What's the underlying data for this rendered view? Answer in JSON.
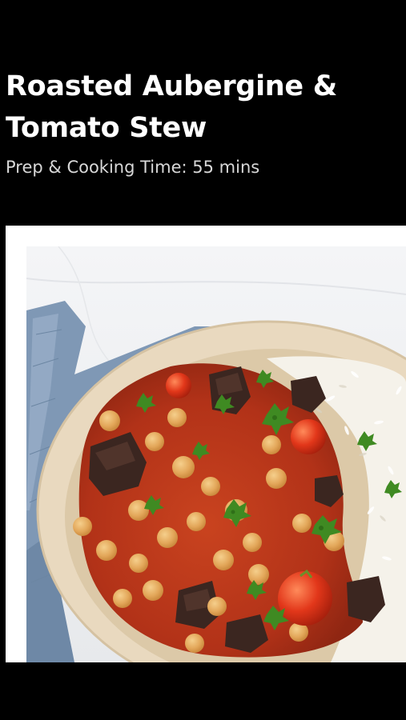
{
  "recipe": {
    "title": "Roasted Aubergine & Tomato Stew",
    "prep_time": "Prep & Cooking Time: 55 mins",
    "photo": "roasted-aubergine-tomato-stew-photo"
  },
  "colors": {
    "background": "#000000",
    "title_text": "#ffffff",
    "subtitle_text": "#d8d8d8",
    "card_border": "#ffffff",
    "napkin": "#7f98b5",
    "bowl": "#e9d9bf",
    "sauce": "#b8361a",
    "chickpea": "#e7ae62",
    "aubergine": "#3b2620",
    "rice": "#f5f2ea",
    "parsley": "#3f8a22",
    "cherry_tomato": "#e2371a"
  }
}
